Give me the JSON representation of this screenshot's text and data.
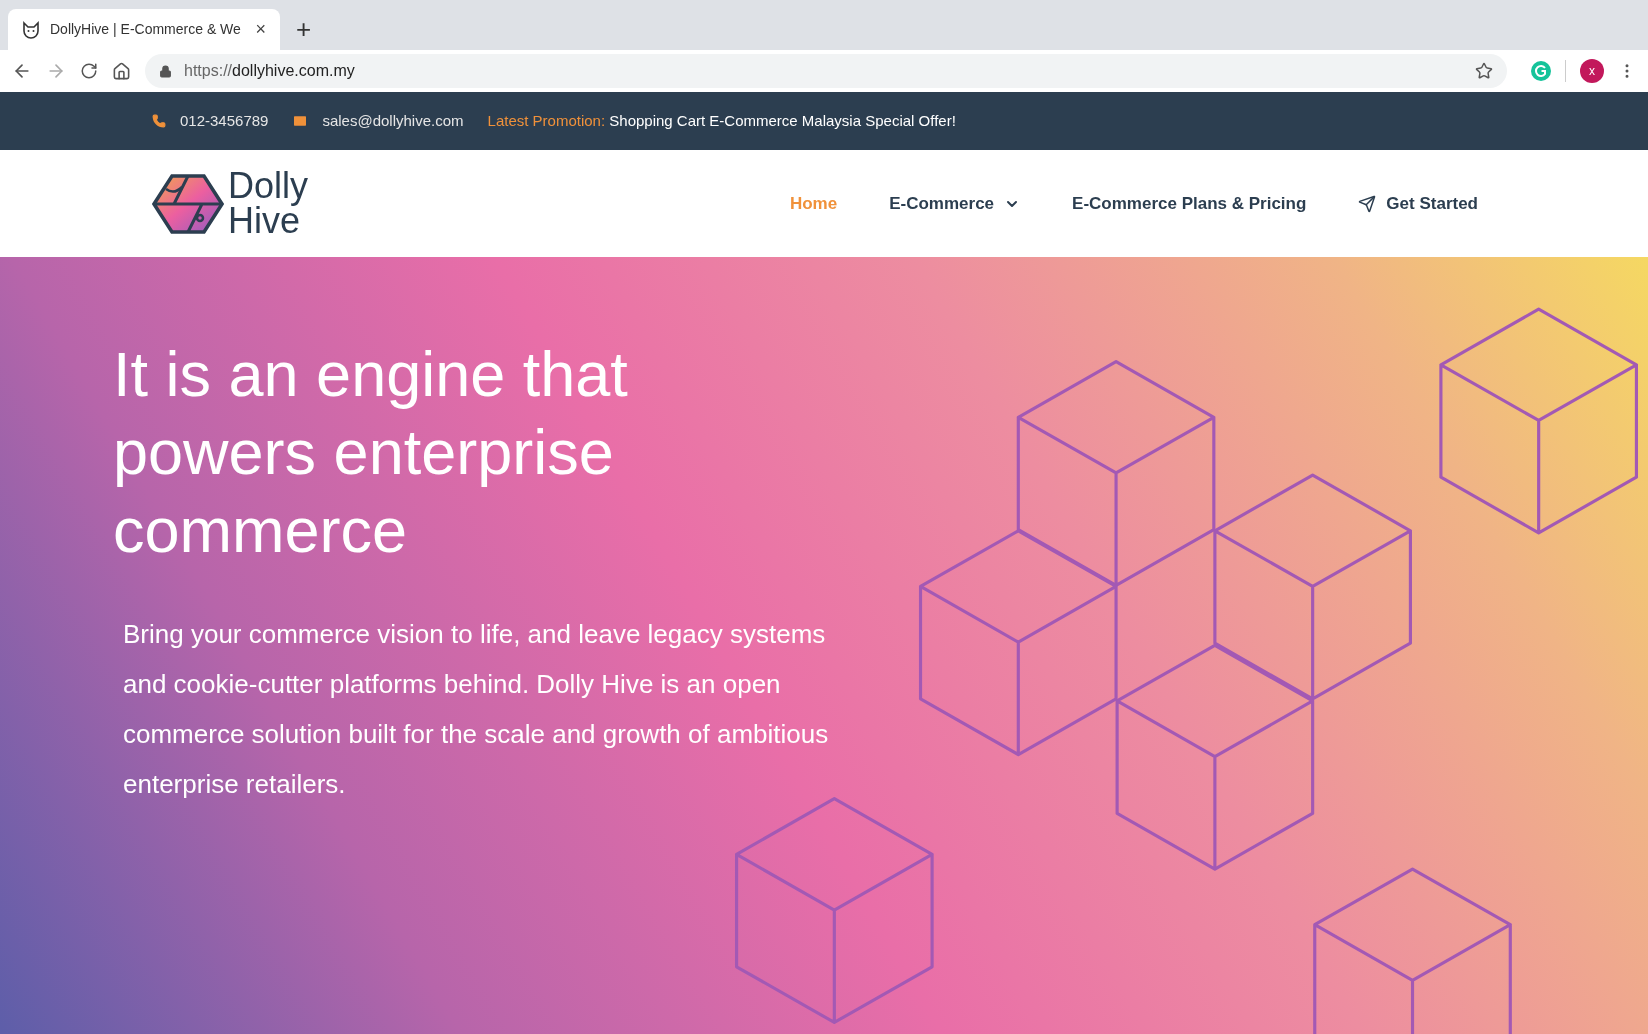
{
  "browser": {
    "tab": {
      "title": "DollyHive | E-Commerce & We",
      "close": "×"
    },
    "new_tab": "+",
    "url": {
      "scheme": "https://",
      "host": "dollyhive.com.my"
    },
    "profile": "x"
  },
  "topbar": {
    "phone": "012-3456789",
    "email": "sales@dollyhive.com",
    "promo_label": "Latest Promotion:",
    "promo_text": "Shopping Cart E-Commerce Malaysia Special Offer!"
  },
  "logo": {
    "line1": "Dolly",
    "line2": "Hive"
  },
  "nav": [
    {
      "label": "Home",
      "kind": "link",
      "selected": true
    },
    {
      "label": "E-Commerce",
      "kind": "dropdown",
      "selected": false
    },
    {
      "label": "E-Commerce Plans & Pricing",
      "kind": "link",
      "selected": false
    },
    {
      "label": "Get Started",
      "kind": "cta",
      "selected": false
    }
  ],
  "hero": {
    "heading": "It is an engine that powers enterprise commerce",
    "text": "Bring your commerce vision to life, and leave legacy systems and cookie-cutter platforms behind. Dolly Hive is an open commerce solution built for the scale and growth of ambitious enterprise retailers."
  }
}
